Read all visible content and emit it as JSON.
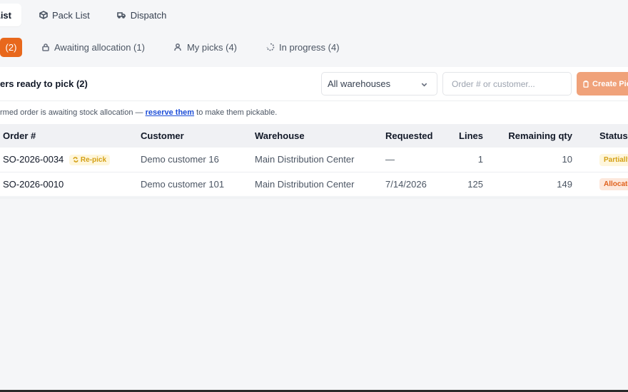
{
  "top_tabs": [
    {
      "label": "List",
      "icon": "list-icon",
      "active": true
    },
    {
      "label": "Pack List",
      "icon": "box-icon",
      "active": false
    },
    {
      "label": "Dispatch",
      "icon": "truck-icon",
      "active": false
    }
  ],
  "sub_tabs": [
    {
      "label": "(2)",
      "icon": "",
      "active": true
    },
    {
      "label": "Awaiting allocation (1)",
      "icon": "lock-icon",
      "active": false
    },
    {
      "label": "My picks (4)",
      "icon": "user-icon",
      "active": false
    },
    {
      "label": "In progress (4)",
      "icon": "spinner-icon",
      "active": false
    }
  ],
  "panel": {
    "title": "ers ready to pick (2)",
    "warehouse_filter": "All warehouses",
    "search_placeholder": "Order # or customer...",
    "create_button": "Create Pic",
    "notice_prefix": "rmed order is awaiting stock allocation — ",
    "notice_link": "reserve them",
    "notice_suffix": " to make them pickable."
  },
  "table": {
    "columns": [
      "Order #",
      "Customer",
      "Warehouse",
      "Requested",
      "Lines",
      "Remaining qty",
      "Status"
    ],
    "rows": [
      {
        "order": "SO-2026-0034",
        "badge": "Re-pick",
        "customer": "Demo customer 16",
        "warehouse": "Main Distribution Center",
        "requested": "—",
        "lines": "1",
        "remaining": "10",
        "status": "Partially"
      },
      {
        "order": "SO-2026-0010",
        "badge": "",
        "customer": "Demo customer 101",
        "warehouse": "Main Distribution Center",
        "requested": "7/14/2026",
        "lines": "125",
        "remaining": "149",
        "status": "Allocate"
      }
    ]
  },
  "colors": {
    "accent": "#e8681c",
    "create_button": "#f0a27a",
    "repick_badge": "#d4a015",
    "allocated_badge": "#e0611c",
    "link": "#1d4ed8"
  }
}
